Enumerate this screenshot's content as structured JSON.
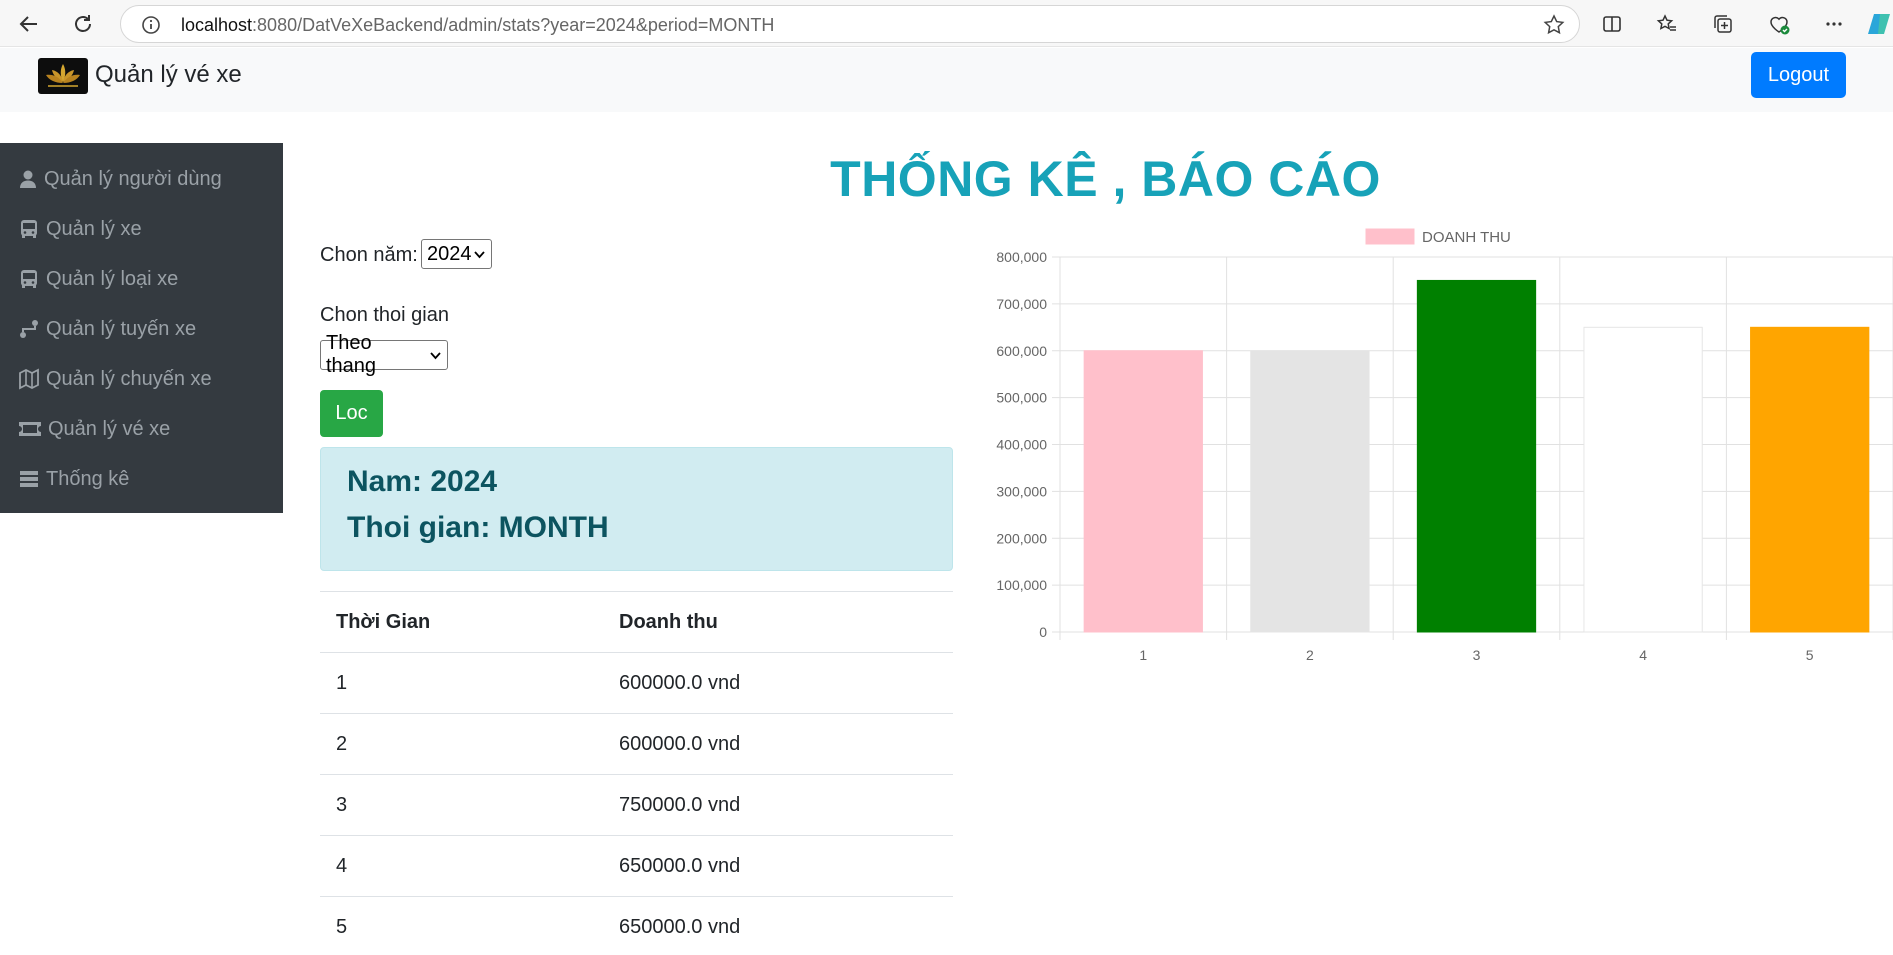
{
  "browser": {
    "url_host": "localhost",
    "url_rest": ":8080/DatVeXeBackend/admin/stats?year=2024&period=MONTH"
  },
  "header": {
    "brand": "Quản lý vé xe",
    "logout_label": "Logout"
  },
  "sidebar": {
    "items": [
      {
        "label": "Quản lý người dùng",
        "icon": "user-icon"
      },
      {
        "label": "Quản lý xe",
        "icon": "bus-icon"
      },
      {
        "label": "Quản lý loại xe",
        "icon": "bus-icon"
      },
      {
        "label": "Quản lý tuyến xe",
        "icon": "route-icon"
      },
      {
        "label": "Quản lý chuyến xe",
        "icon": "map-icon"
      },
      {
        "label": "Quản lý vé xe",
        "icon": "ticket-icon"
      },
      {
        "label": "Thống kê",
        "icon": "list-icon"
      }
    ]
  },
  "main": {
    "title": "THỐNG KÊ , BÁO CÁO",
    "year_label": "Chon năm:",
    "year_value": "2024",
    "period_label": "Chon thoi gian",
    "period_value": "Theo thang",
    "filter_label": "Loc",
    "info_year": "Nam: 2024",
    "info_period": "Thoi gian: MONTH",
    "table": {
      "headers": [
        "Thời Gian",
        "Doanh thu"
      ],
      "rows": [
        [
          "1",
          "600000.0 vnd"
        ],
        [
          "2",
          "600000.0 vnd"
        ],
        [
          "3",
          "750000.0 vnd"
        ],
        [
          "4",
          "650000.0 vnd"
        ],
        [
          "5",
          "650000.0 vnd"
        ]
      ]
    }
  },
  "chart_data": {
    "type": "bar",
    "categories": [
      "1",
      "2",
      "3",
      "4",
      "5"
    ],
    "series": [
      {
        "name": "DOANH THU",
        "values": [
          600000,
          600000,
          750000,
          650000,
          650000
        ]
      }
    ],
    "bar_colors": [
      "#ffc0cb",
      "#e4e4e4",
      "#008000",
      "#ffffff",
      "#ffa500"
    ],
    "legend_color": "#ffc0cb",
    "yticks": [
      "0",
      "100,000",
      "200,000",
      "300,000",
      "400,000",
      "500,000",
      "600,000",
      "700,000",
      "800,000"
    ],
    "ylim": [
      0,
      800000
    ],
    "grid": true,
    "legend": "top"
  }
}
